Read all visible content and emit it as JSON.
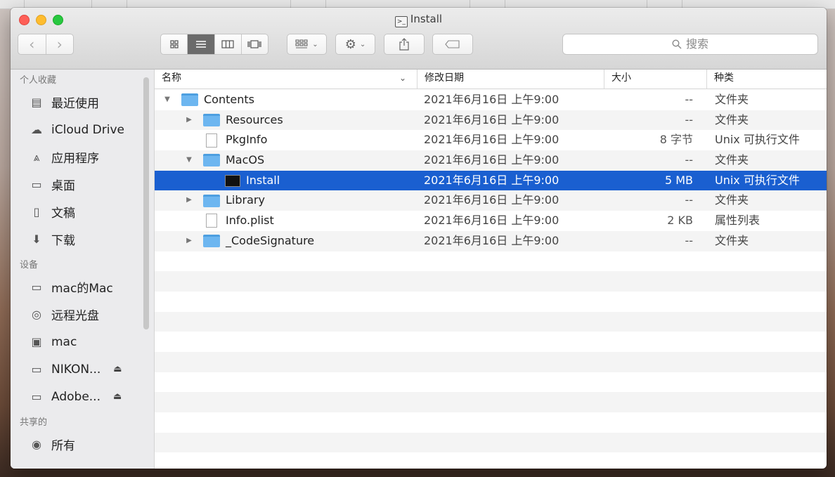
{
  "window": {
    "title": "Install"
  },
  "toolbar": {
    "back": "‹",
    "forward": "›",
    "search_placeholder": "搜索"
  },
  "sidebar": {
    "favorites_header": "个人收藏",
    "favorites": [
      {
        "label": "最近使用",
        "icon": "recents-icon"
      },
      {
        "label": "iCloud Drive",
        "icon": "icloud-icon"
      },
      {
        "label": "应用程序",
        "icon": "applications-icon"
      },
      {
        "label": "桌面",
        "icon": "desktop-icon"
      },
      {
        "label": "文稿",
        "icon": "documents-icon"
      },
      {
        "label": "下载",
        "icon": "downloads-icon"
      }
    ],
    "devices_header": "设备",
    "devices": [
      {
        "label": "mac的Mac",
        "icon": "computer-icon"
      },
      {
        "label": "远程光盘",
        "icon": "disc-icon"
      },
      {
        "label": "mac",
        "icon": "disk-icon"
      },
      {
        "label": "NIKON...",
        "icon": "volume-icon",
        "eject": true
      },
      {
        "label": "Adobe...",
        "icon": "volume-icon",
        "eject": true
      }
    ],
    "shared_header": "共享的",
    "shared": [
      {
        "label": "所有",
        "icon": "network-icon"
      }
    ]
  },
  "columns": {
    "name": "名称",
    "date": "修改日期",
    "size": "大小",
    "kind": "种类"
  },
  "files": [
    {
      "name": "Contents",
      "indent": 0,
      "disclosure": "open",
      "type": "folder",
      "date": "2021年6月16日 上午9:00",
      "size": "--",
      "kind": "文件夹"
    },
    {
      "name": "Resources",
      "indent": 1,
      "disclosure": "closed",
      "type": "folder",
      "date": "2021年6月16日 上午9:00",
      "size": "--",
      "kind": "文件夹"
    },
    {
      "name": "PkgInfo",
      "indent": 1,
      "disclosure": "none",
      "type": "doc",
      "date": "2021年6月16日 上午9:00",
      "size": "8 字节",
      "kind": "Unix 可执行文件"
    },
    {
      "name": "MacOS",
      "indent": 1,
      "disclosure": "open",
      "type": "folder",
      "date": "2021年6月16日 上午9:00",
      "size": "--",
      "kind": "文件夹"
    },
    {
      "name": "Install",
      "indent": 2,
      "disclosure": "none",
      "type": "exec",
      "date": "2021年6月16日 上午9:00",
      "size": "5 MB",
      "kind": "Unix 可执行文件",
      "selected": true
    },
    {
      "name": "Library",
      "indent": 1,
      "disclosure": "closed",
      "type": "folder",
      "date": "2021年6月16日 上午9:00",
      "size": "--",
      "kind": "文件夹"
    },
    {
      "name": "Info.plist",
      "indent": 1,
      "disclosure": "none",
      "type": "doc",
      "date": "2021年6月16日 上午9:00",
      "size": "2 KB",
      "kind": "属性列表"
    },
    {
      "name": "_CodeSignature",
      "indent": 1,
      "disclosure": "closed",
      "type": "folder",
      "date": "2021年6月16日 上午9:00",
      "size": "--",
      "kind": "文件夹"
    }
  ],
  "colors": {
    "selection": "#1a5fd0",
    "folder": "#6db6f0"
  }
}
